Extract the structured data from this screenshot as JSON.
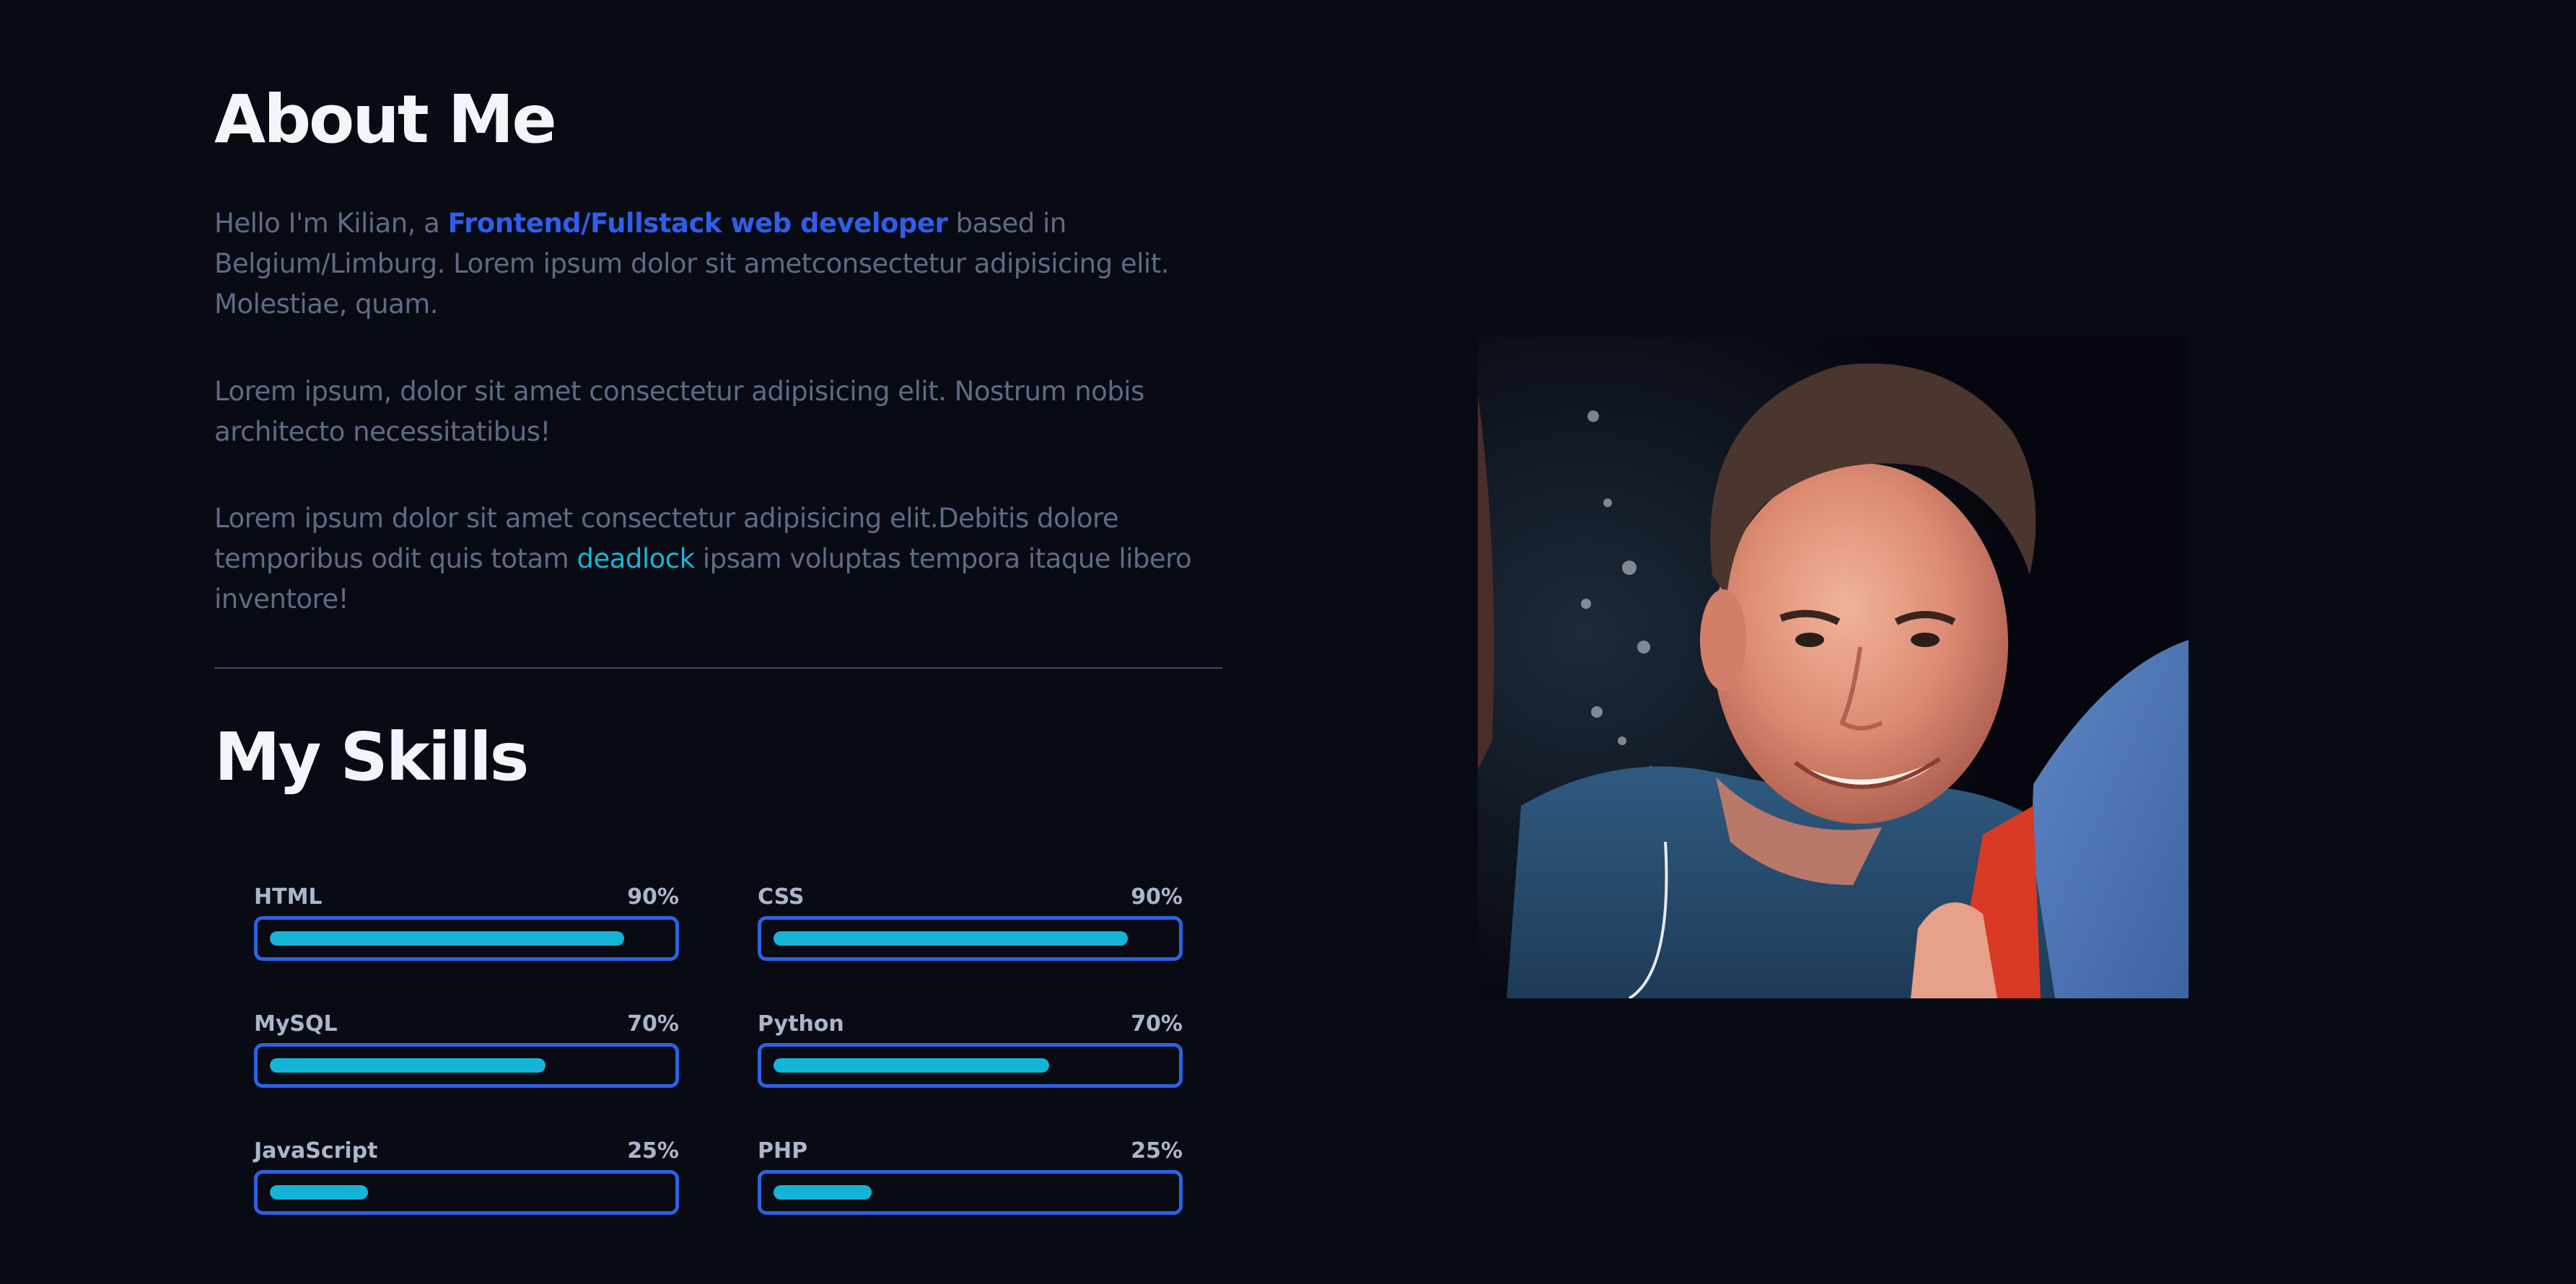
{
  "about": {
    "title": "About Me",
    "p1_before": "Hello I'm Kilian, a ",
    "p1_highlight": "Frontend/Fullstack web developer",
    "p1_after": " based in Belgium/Limburg. Lorem ipsum dolor sit ametconsectetur adipisicing elit. Molestiae, quam.",
    "p2": "Lorem ipsum, dolor sit amet consectetur adipisicing elit. Nostrum nobis architecto necessitatibus!",
    "p3_before": "Lorem ipsum dolor sit amet consectetur adipisicing elit.Debitis dolore temporibus odit quis totam ",
    "p3_link": "deadlock",
    "p3_after": " ipsam voluptas tempora itaque libero inventore!"
  },
  "skills": {
    "title": "My Skills",
    "items": [
      {
        "name": "HTML",
        "percent_label": "90%",
        "level": 0.9
      },
      {
        "name": "CSS",
        "percent_label": "90%",
        "level": 0.9
      },
      {
        "name": "MySQL",
        "percent_label": "70%",
        "level": 0.7
      },
      {
        "name": "Python",
        "percent_label": "70%",
        "level": 0.7
      },
      {
        "name": "JavaScript",
        "percent_label": "25%",
        "level": 0.25
      },
      {
        "name": "PHP",
        "percent_label": "25%",
        "level": 0.25
      }
    ]
  },
  "colors": {
    "background": "#080b13",
    "heading": "#f2f5f9",
    "body_text": "#5d6c85",
    "highlight": "#2f5ee8",
    "link": "#19b6d4",
    "bar_border": "#2b63e6",
    "bar_fill": "#14b4d6"
  },
  "photo": {
    "subject": "portrait photo of smiling young man in blue t-shirt"
  }
}
